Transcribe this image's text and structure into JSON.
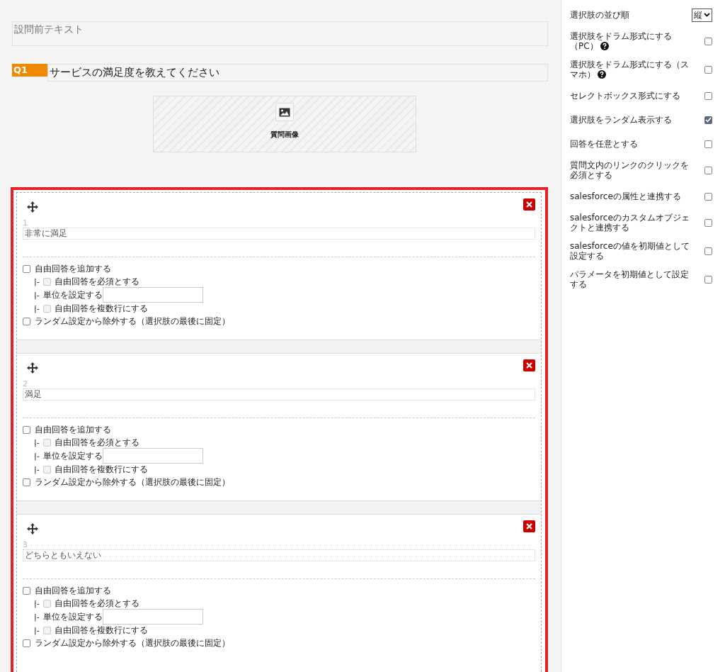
{
  "pre_text": {
    "placeholder": "設問前テキスト"
  },
  "question": {
    "badge": "Q1",
    "text": "サービスの満足度を教えてください"
  },
  "question_image": {
    "label": "質問画像"
  },
  "options": [
    {
      "number": "1",
      "text": "非常に満足",
      "free_answer": {
        "label": "自由回答を追加する",
        "checked": false
      },
      "required": {
        "prefix": "|-",
        "label": "自由回答を必須とする",
        "checked": false,
        "disabled": true
      },
      "unit": {
        "prefix": "|-",
        "label": "単位を設定する"
      },
      "multiline": {
        "prefix": "|-",
        "label": "自由回答を複数行にする",
        "checked": false,
        "disabled": true
      },
      "exclude_random": {
        "label": "ランダム設定から除外する（選択肢の最後に固定）",
        "checked": false
      }
    },
    {
      "number": "2",
      "text": "満足",
      "free_answer": {
        "label": "自由回答を追加する",
        "checked": false
      },
      "required": {
        "prefix": "|-",
        "label": "自由回答を必須とする",
        "checked": false,
        "disabled": true
      },
      "unit": {
        "prefix": "|-",
        "label": "単位を設定する"
      },
      "multiline": {
        "prefix": "|-",
        "label": "自由回答を複数行にする",
        "checked": false,
        "disabled": true
      },
      "exclude_random": {
        "label": "ランダム設定から除外する（選択肢の最後に固定）",
        "checked": false
      }
    },
    {
      "number": "3",
      "text": "どちらともいえない",
      "free_answer": {
        "label": "自由回答を追加する",
        "checked": false
      },
      "required": {
        "prefix": "|-",
        "label": "自由回答を必須とする",
        "checked": false,
        "disabled": true
      },
      "unit": {
        "prefix": "|-",
        "label": "単位を設定する"
      },
      "multiline": {
        "prefix": "|-",
        "label": "自由回答を複数行にする",
        "checked": false,
        "disabled": true
      },
      "exclude_random": {
        "label": "ランダム設定から除外する（選択肢の最後に固定）",
        "checked": false
      }
    }
  ],
  "settings": [
    {
      "kind": "select",
      "label": "選択肢の並び順",
      "value": "縦"
    },
    {
      "kind": "checkbox",
      "label": "選択肢をドラム形式にする（PC）",
      "help": true,
      "checked": false
    },
    {
      "kind": "checkbox",
      "label": "選択肢をドラム形式にする（スマホ）",
      "help": true,
      "checked": false
    },
    {
      "kind": "checkbox",
      "label": "セレクトボックス形式にする",
      "help": false,
      "checked": false
    },
    {
      "kind": "checkbox",
      "label": "選択肢をランダム表示する",
      "help": false,
      "checked": true
    },
    {
      "kind": "checkbox",
      "label": "回答を任意とする",
      "help": false,
      "checked": false
    },
    {
      "kind": "checkbox",
      "label": "質問文内のリンクのクリックを必須とする",
      "help": false,
      "checked": false
    },
    {
      "kind": "checkbox",
      "label": "salesforceの属性と連携する",
      "help": false,
      "checked": false
    },
    {
      "kind": "checkbox",
      "label": "salesforceのカスタムオブジェクトと連携する",
      "help": false,
      "checked": false
    },
    {
      "kind": "checkbox",
      "label": "salesforceの値を初期値として設定する",
      "help": false,
      "checked": false
    },
    {
      "kind": "checkbox",
      "label": "パラメータを初期値として設定する",
      "help": false,
      "checked": false
    }
  ]
}
